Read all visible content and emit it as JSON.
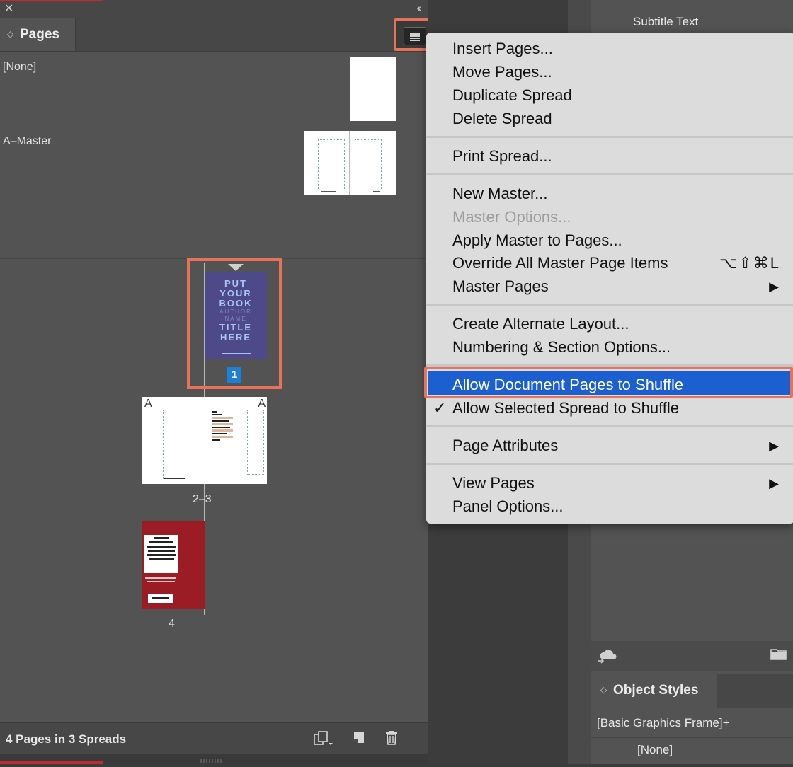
{
  "panel": {
    "close_glyph": "✕",
    "collapse_glyph": "‹‹",
    "tab_arrow": "◇",
    "tab_title": "Pages",
    "menu_icon": "panel-menu-icon",
    "masters": [
      {
        "label": "[None]"
      },
      {
        "label": "A–Master"
      }
    ],
    "cover": {
      "lines_big_1": [
        "PUT",
        "YOUR",
        "BOOK"
      ],
      "lines_small": [
        "AUTHOR",
        "NAME"
      ],
      "lines_big_2": [
        "TITLE",
        "HERE"
      ],
      "page_number": "1"
    },
    "spread_label": "2–3",
    "spread_prefix_left": "A",
    "spread_prefix_right": "A",
    "page4_label": "4",
    "status": "4 Pages in 3 Spreads",
    "status_icons": [
      "edit-page-size-icon",
      "new-page-icon",
      "trash-icon"
    ]
  },
  "right": {
    "subtitle_text": "Subtitle Text",
    "object_styles_title": "Object Styles",
    "object_styles_items": [
      "[Basic Graphics Frame]+",
      "[None]"
    ]
  },
  "menu": {
    "items": [
      {
        "label": "Insert Pages..."
      },
      {
        "label": "Move Pages..."
      },
      {
        "label": "Duplicate Spread"
      },
      {
        "label": "Delete Spread"
      },
      {
        "label": "Print Spread..."
      },
      {
        "label": "New Master..."
      },
      {
        "label": "Master Options...",
        "disabled": true
      },
      {
        "label": "Apply Master to Pages..."
      },
      {
        "label": "Override All Master Page Items",
        "shortcut": "⌥⇧⌘L"
      },
      {
        "label": "Master Pages",
        "submenu": true
      },
      {
        "label": "Create Alternate Layout..."
      },
      {
        "label": "Numbering & Section Options..."
      },
      {
        "label": "Allow Document Pages to Shuffle",
        "highlighted": true
      },
      {
        "label": "Allow Selected Spread to Shuffle",
        "checked": true
      },
      {
        "label": "Page Attributes",
        "submenu": true
      },
      {
        "label": "View Pages",
        "submenu": true
      },
      {
        "label": "Panel Options..."
      }
    ],
    "submenu_glyph": "▶",
    "check_glyph": "✓"
  },
  "colors": {
    "highlight_outline": "#e4735a",
    "menu_selection": "#1c5fd0",
    "page_badge": "#1d7fd6",
    "cover_bg": "#4e4a8a",
    "page4_bg": "#9b1c24"
  }
}
